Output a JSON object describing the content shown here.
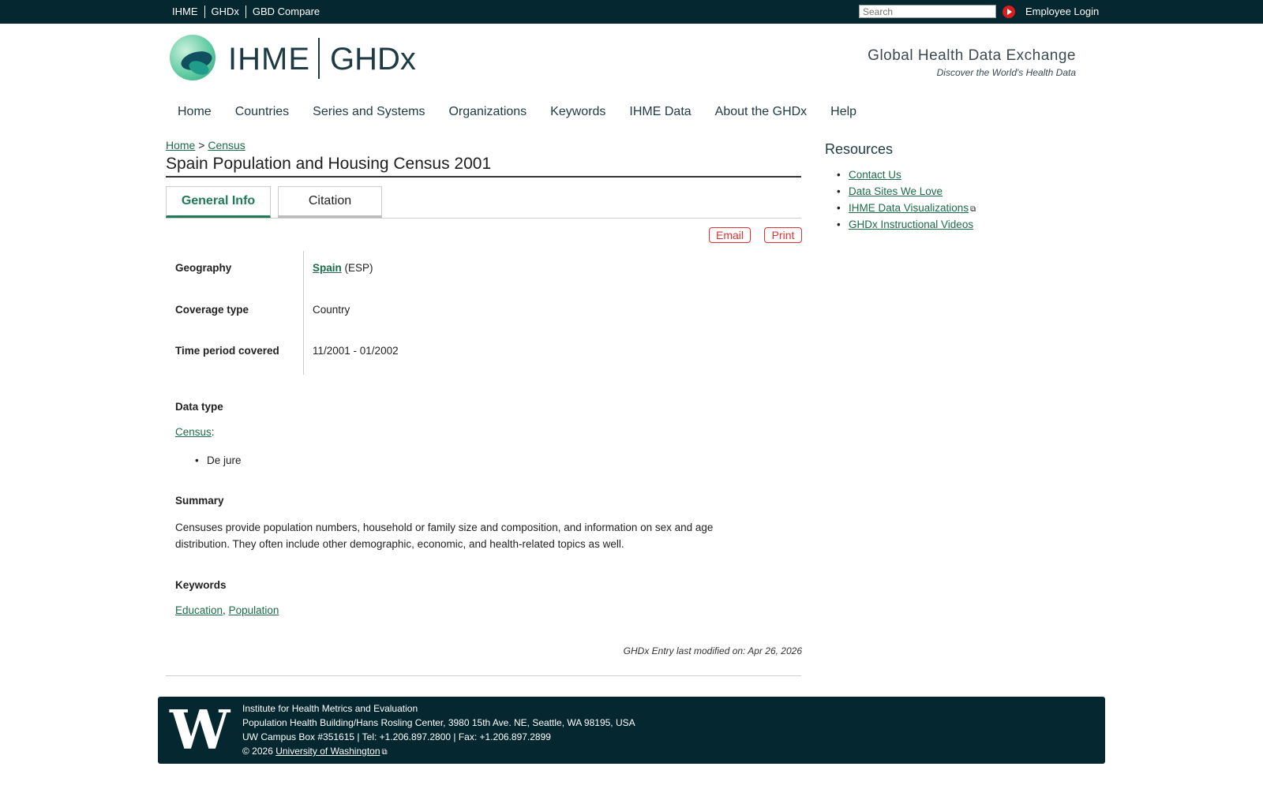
{
  "topbar": {
    "links": [
      "IHME",
      "GHDx",
      "GBD Compare"
    ],
    "search_placeholder": "Search",
    "employee_login": "Employee Login"
  },
  "brand": {
    "ihme": "IHME",
    "ghdx": "GHDx",
    "tagline": "Global Health Data Exchange",
    "subtagline": "Discover the World's Health Data"
  },
  "nav": [
    "Home",
    "Countries",
    "Series and Systems",
    "Organizations",
    "Keywords",
    "IHME Data",
    "About the GHDx",
    "Help"
  ],
  "breadcrumb": {
    "home": "Home",
    "sep": ">",
    "current": "Census"
  },
  "page_title": "Spain Population and Housing Census 2001",
  "tabs": {
    "general": "General Info",
    "citation": "Citation"
  },
  "actions": {
    "email": "Email",
    "print": "Print"
  },
  "details": {
    "geography_label": "Geography",
    "geography_link": "Spain",
    "geography_code": "(ESP)",
    "coverage_label": "Coverage type",
    "coverage_value": "Country",
    "time_label": "Time period covered",
    "time_value": "11/2001 - 01/2002"
  },
  "data_type": {
    "heading": "Data type",
    "link": "Census",
    "colon": ":",
    "items": [
      "De jure"
    ]
  },
  "summary": {
    "heading": "Summary",
    "line1": "Censuses provide population numbers, household or family size and composition, and information on sex and age",
    "line2": "distribution. They often include other demographic, economic, and health-related topics as well."
  },
  "keywords": {
    "heading": "Keywords",
    "items": [
      "Education",
      "Population"
    ],
    "sep": ","
  },
  "modified": "GHDx Entry last modified on: Apr 26, 2026",
  "resources": {
    "heading": "Resources",
    "items": [
      "Contact Us",
      "Data Sites We Love",
      "IHME Data Visualizations",
      "GHDx Instructional Videos"
    ]
  },
  "footer": {
    "logo": "W",
    "line1": "Institute for Health Metrics and Evaluation",
    "line2": "Population Health Building/Hans Rosling Center, 3980 15th Ave. NE, Seattle, WA 98195, USA",
    "line3": "UW Campus Box #351615 | Tel: +1.206.897.2800 | Fax: +1.206.897.2899",
    "copyright": "© 2026",
    "uw_link": "University of Washington"
  },
  "colors": {
    "topbar": "#05272f",
    "link": "#1c6b4a",
    "accent_red": "#d33333"
  }
}
